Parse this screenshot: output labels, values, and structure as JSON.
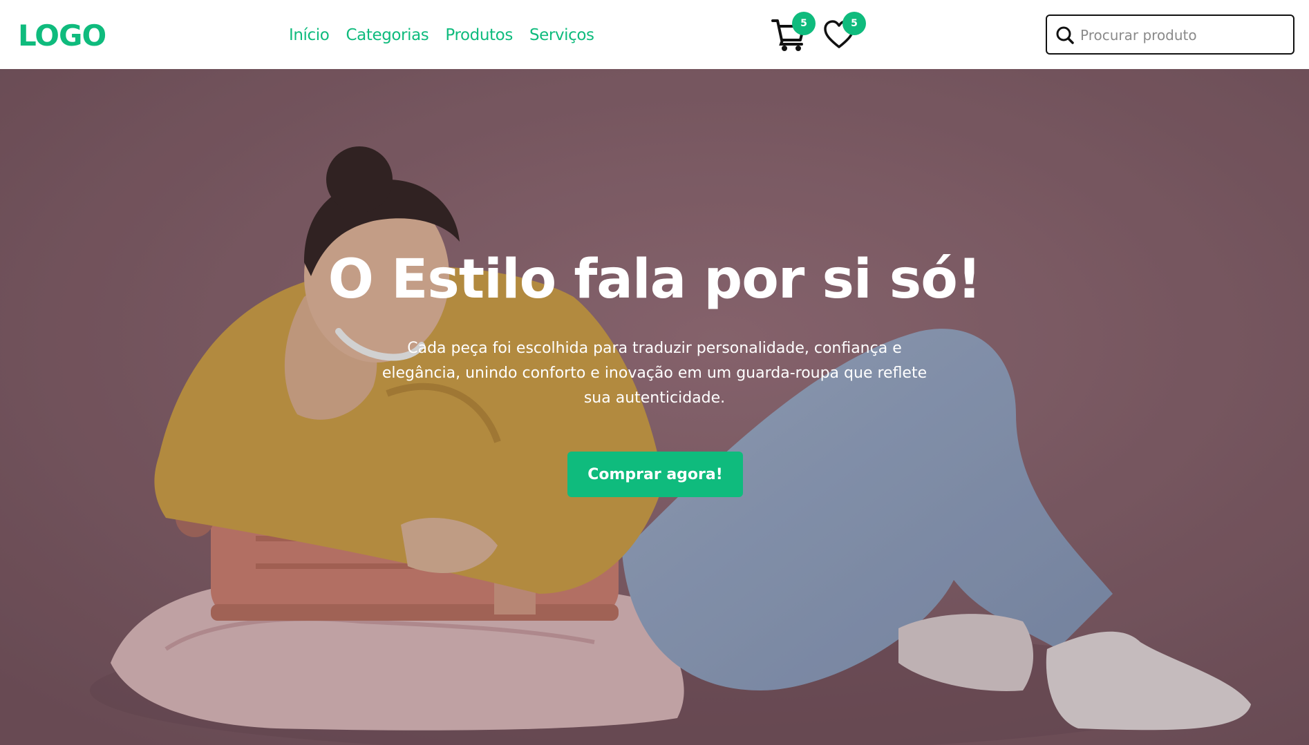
{
  "header": {
    "logo": "LOGO",
    "nav": [
      {
        "label": "Início"
      },
      {
        "label": "Categorias"
      },
      {
        "label": "Produtos"
      },
      {
        "label": "Serviços"
      }
    ],
    "cart": {
      "icon": "cart-icon",
      "count": "5"
    },
    "wishlist": {
      "icon": "heart-icon",
      "count": "5"
    },
    "search": {
      "icon": "search-icon",
      "placeholder": "Procurar produto",
      "value": ""
    }
  },
  "hero": {
    "title": "O Estilo fala por si só!",
    "text": "Cada peça foi escolhida para traduzir personalidade, confiança e elegância, unindo conforto e inovação em um guarda-roupa que reflete sua autenticidade.",
    "cta_label": "Comprar agora!"
  },
  "colors": {
    "accent": "#0fbb7d",
    "hero_background": "#8d6d77",
    "text_light": "#ffffff"
  }
}
